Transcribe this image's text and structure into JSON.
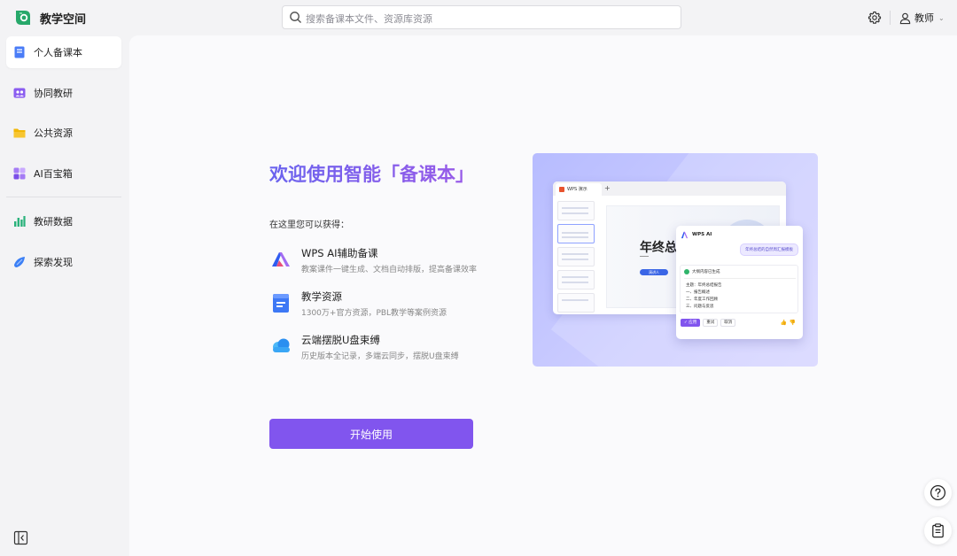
{
  "header": {
    "app_title": "教学空间",
    "search_placeholder": "搜索备课本文件、资源库资源",
    "user_name": "教师"
  },
  "sidebar": {
    "items": [
      {
        "label": "个人备课本",
        "icon": "notebook-icon",
        "active": true
      },
      {
        "label": "协同教研",
        "icon": "collab-icon",
        "active": false
      },
      {
        "label": "公共资源",
        "icon": "folder-icon",
        "active": false
      },
      {
        "label": "AI百宝箱",
        "icon": "ai-toolbox-icon",
        "active": false
      },
      {
        "label": "教研数据",
        "icon": "bar-chart-icon",
        "active": false
      },
      {
        "label": "探索发现",
        "icon": "explore-icon",
        "active": false
      }
    ]
  },
  "main": {
    "welcome_title": "欢迎使用智能「备课本」",
    "intro": "在这里您可以获得：",
    "features": [
      {
        "title": "WPS AI辅助备课",
        "desc": "教案课件一键生成、文档自动排版，提高备课效率",
        "icon": "wps-ai-icon"
      },
      {
        "title": "教学资源",
        "desc": "1300万+官方资源，PBL教学等案例资源",
        "icon": "resource-book-icon"
      },
      {
        "title": "云端摆脱U盘束缚",
        "desc": "历史版本全记录，多端云同步，摆脱U盘束缚",
        "icon": "cloud-icon"
      }
    ],
    "start_button": "开始使用"
  },
  "illustration": {
    "tab_title": "WPS 演示",
    "slide_title": "年终总结",
    "slide_button": "演讲人",
    "ai_label": "WPS AI",
    "ai_prompt": "年终总结的自然周汇报模板",
    "ai_status": "大纲内容已生成",
    "outline": [
      "主题：年终总结报告",
      "一、报告概述",
      "二、年度工作回顾",
      "三、问题与反思"
    ],
    "actions": {
      "apply": "✓ 应用",
      "retry": "重试",
      "cancel": "取消"
    }
  },
  "colors": {
    "accent": "#8155ee",
    "title_gradient_start": "#6a63ee",
    "title_gradient_end": "#9a5ae8",
    "illustration_bg": "#c3c6ff"
  }
}
